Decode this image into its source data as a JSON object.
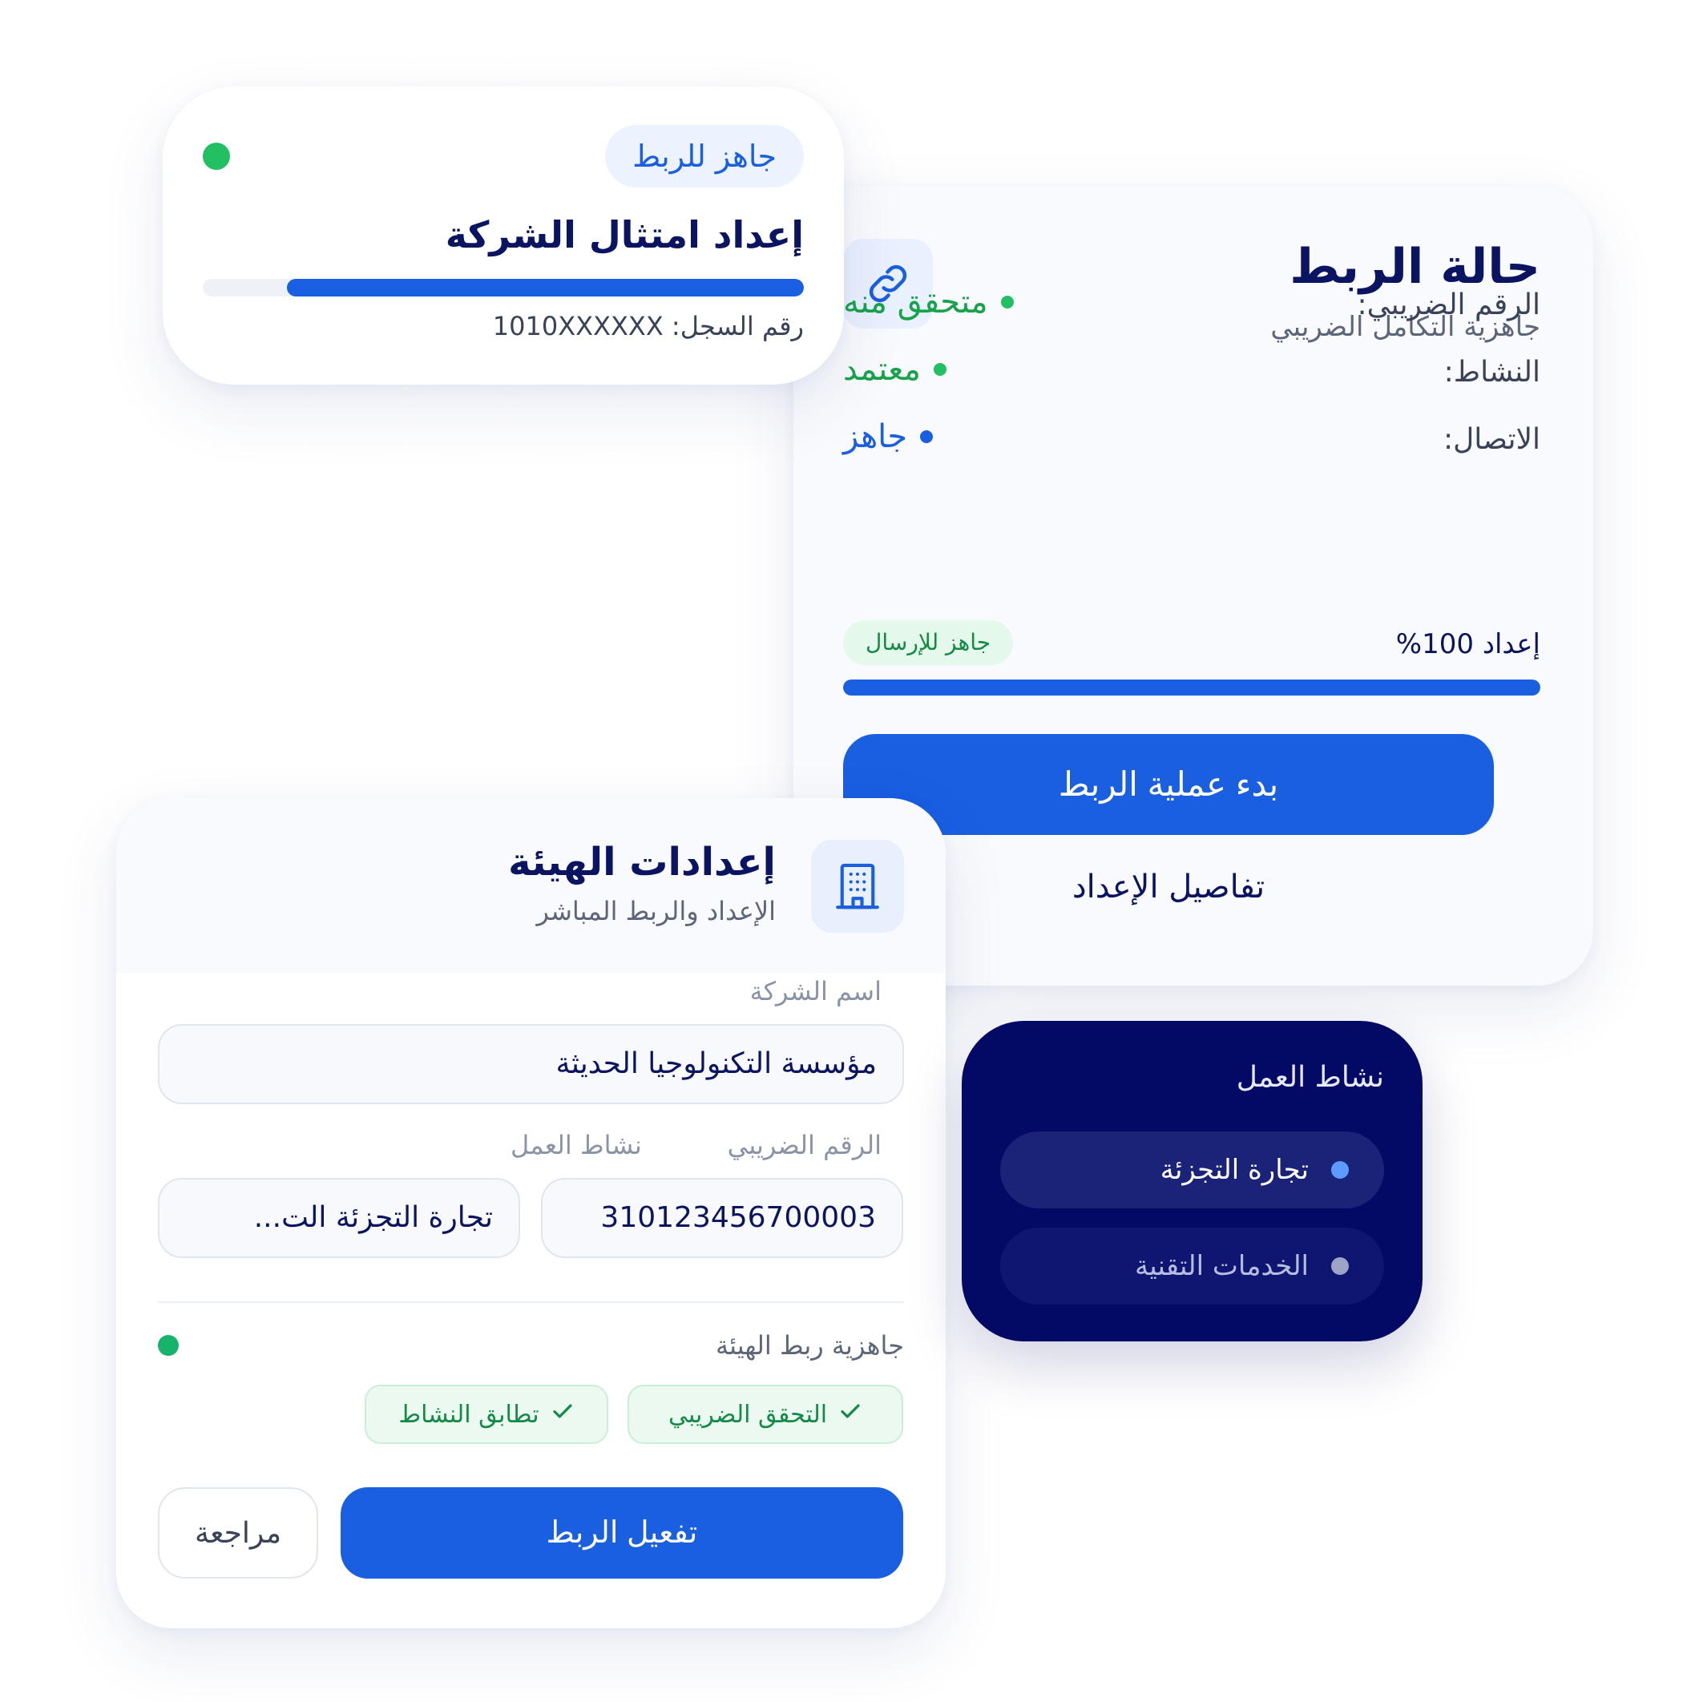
{
  "company_card": {
    "badge": "جاهز للربط",
    "title": "إعداد امتثال الشركة",
    "progress": 0.86,
    "registration_label": "رقم السجل: 1010XXXXXX",
    "status_dot_color": "#22c063"
  },
  "link_status": {
    "title": "حالة الربط",
    "subtitle": "جاهزية التكامل الضريبي",
    "icon": "link-icon",
    "rows": [
      {
        "label": "الرقم الضريبي:",
        "value": "متحقق منه",
        "color": "#16a34a"
      },
      {
        "label": "النشاط:",
        "value": "معتمد",
        "color": "#16a34a"
      },
      {
        "label": "الاتصال:",
        "value": "جاهز",
        "color": "#1a5fe0"
      }
    ],
    "setup_label": "إعداد 100%",
    "setup_progress": 1.0,
    "send_badge": "جاهز للإرسال",
    "start_button": "بدء عملية الربط",
    "details_link": "تفاصيل الإعداد"
  },
  "authority": {
    "title": "إعدادات الهيئة",
    "subtitle": "الإعداد والربط المباشر",
    "icon": "building-icon",
    "company_name_label": "اسم الشركة",
    "company_name_value": "مؤسسة التكنولوجيا الحديثة",
    "tax_number_label": "الرقم الضريبي",
    "tax_number_value": "310123456700003",
    "activity_label": "نشاط العمل",
    "activity_value": "تجارة التجزئة الت...",
    "readiness_label": "جاهزية ربط الهيئة",
    "chips": [
      "التحقق الضريبي",
      "تطابق النشاط"
    ],
    "activate_button": "تفعيل الربط",
    "review_button": "مراجعة"
  },
  "activity_card": {
    "title": "نشاط العمل",
    "options": [
      {
        "label": "تجارة التجزئة",
        "selected": true
      },
      {
        "label": "الخدمات التقنية",
        "selected": false
      }
    ]
  },
  "colors": {
    "primary": "#1a5fe0",
    "navy": "#0b1460",
    "dark_card": "#020a66",
    "success": "#16a34a"
  }
}
